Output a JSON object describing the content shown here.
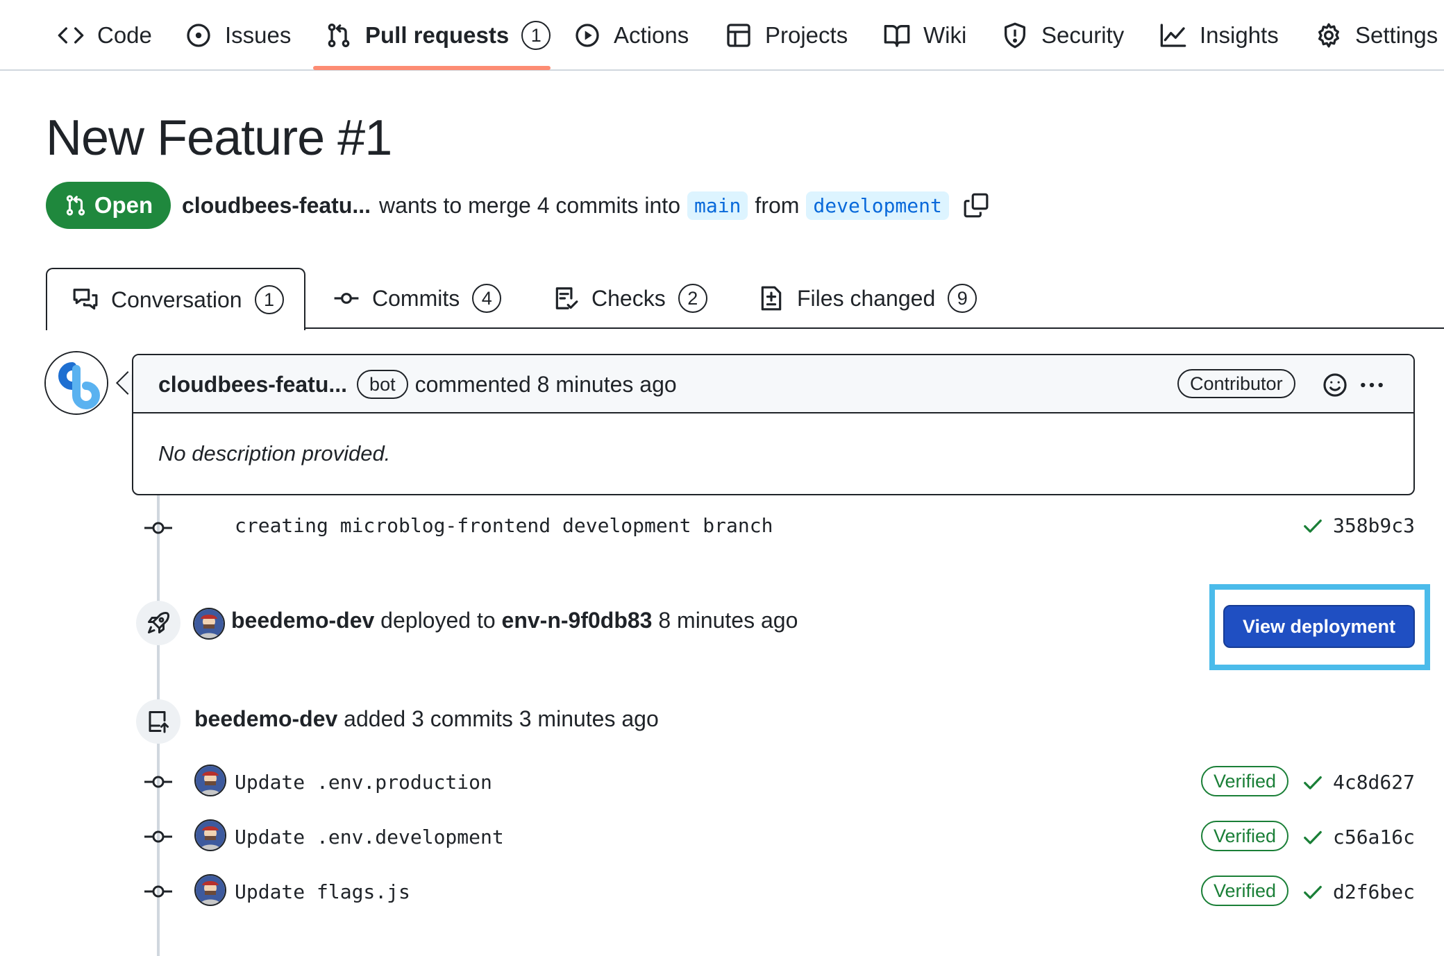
{
  "repo_nav": {
    "items": [
      {
        "label": "Code",
        "icon": "code-icon"
      },
      {
        "label": "Issues",
        "icon": "issue-icon"
      },
      {
        "label": "Pull requests",
        "icon": "pull-request-icon",
        "count": "1",
        "active": true
      },
      {
        "label": "Actions",
        "icon": "play-icon"
      },
      {
        "label": "Projects",
        "icon": "table-icon"
      },
      {
        "label": "Wiki",
        "icon": "book-icon"
      },
      {
        "label": "Security",
        "icon": "shield-icon"
      },
      {
        "label": "Insights",
        "icon": "graph-icon"
      },
      {
        "label": "Settings",
        "icon": "gear-icon"
      }
    ]
  },
  "pr": {
    "title": "New Feature #1",
    "state": "Open",
    "author": "cloudbees-featu...",
    "merge_text": "wants to merge 4 commits into",
    "base_branch": "main",
    "from_text": "from",
    "head_branch": "development"
  },
  "tabs": [
    {
      "label": "Conversation",
      "count": "1",
      "icon": "comment-discussion-icon"
    },
    {
      "label": "Commits",
      "count": "4",
      "icon": "commit-icon"
    },
    {
      "label": "Checks",
      "count": "2",
      "icon": "checklist-icon"
    },
    {
      "label": "Files changed",
      "count": "9",
      "icon": "file-diff-icon"
    }
  ],
  "comment": {
    "author": "cloudbees-featu...",
    "bot_label": "bot",
    "action": "commented 8 minutes ago",
    "role": "Contributor",
    "body": "No description provided."
  },
  "timeline": {
    "first_commit": {
      "message": "creating microblog-frontend development branch",
      "sha": "358b9c3"
    },
    "deployment": {
      "actor": "beedemo-dev",
      "middle": "deployed to",
      "environment": "env-n-9f0db83",
      "time": "8 minutes ago",
      "button_label": "View deployment"
    },
    "push": {
      "actor": "beedemo-dev",
      "text": "added 3 commits 3 minutes ago"
    },
    "commits": [
      {
        "message": "Update .env.production",
        "verified": "Verified",
        "sha": "4c8d627"
      },
      {
        "message": "Update .env.development",
        "verified": "Verified",
        "sha": "c56a16c"
      },
      {
        "message": "Update flags.js",
        "verified": "Verified",
        "sha": "d2f6bec"
      }
    ]
  },
  "colors": {
    "open_green": "#1f883d",
    "branch_bg": "#ddf4ff",
    "branch_text": "#0969da",
    "deploy_button": "#1f4fc2",
    "highlight": "#4bbbea",
    "verified_green": "#1a7f37",
    "active_tab_underline": "#fd8c73"
  }
}
